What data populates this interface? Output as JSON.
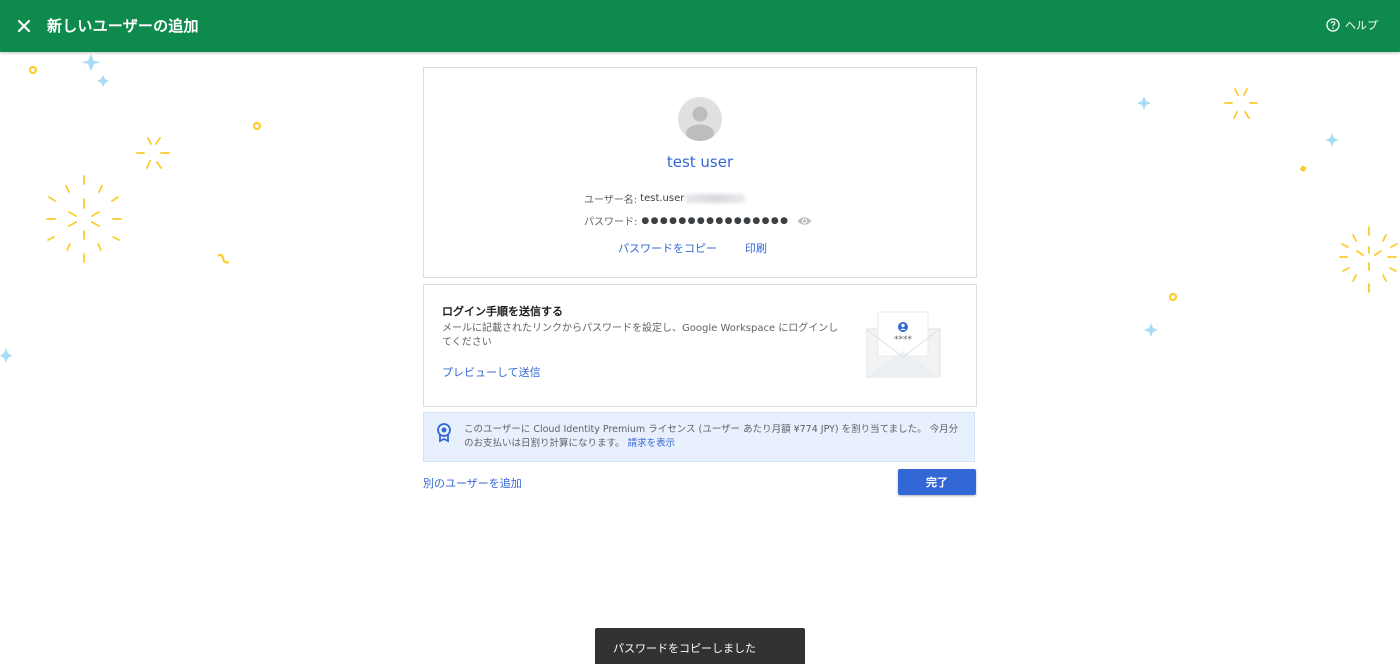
{
  "header": {
    "title": "新しいユーザーの追加",
    "help_label": "ヘルプ",
    "background_color": "#0f8a4d"
  },
  "user_card": {
    "display_name": "test user",
    "username_label": "ユーザー名:",
    "username_value": "test.user",
    "password_label": "パスワード:",
    "password_masked": "●●●●●●●●●●●●●●●●",
    "copy_password_link": "パスワードをコピー",
    "print_link": "印刷"
  },
  "login_card": {
    "title": "ログイン手順を送信する",
    "description": "メールに記載されたリンクからパスワードを設定し、Google Workspace にログインしてください",
    "preview_link": "プレビューして送信",
    "envelope_mask": "****"
  },
  "notice": {
    "text": "このユーザーに Cloud Identity Premium ライセンス (ユーザー あたり月額 ¥774 JPY) を割り当てました。 今月分のお支払いは日割り計算になります。",
    "billing_link": "請求を表示"
  },
  "footer": {
    "add_another_link": "別のユーザーを追加",
    "done_button": "完了"
  },
  "toast": {
    "message": "パスワードをコピーしました"
  },
  "colors": {
    "accent": "#3367d6",
    "confetti_yellow": "#fbcc2d",
    "confetti_blue": "#a8dcf5"
  },
  "icons": [
    "close-icon",
    "help-icon",
    "avatar-icon",
    "eye-icon",
    "envelope-icon",
    "license-badge-icon"
  ]
}
